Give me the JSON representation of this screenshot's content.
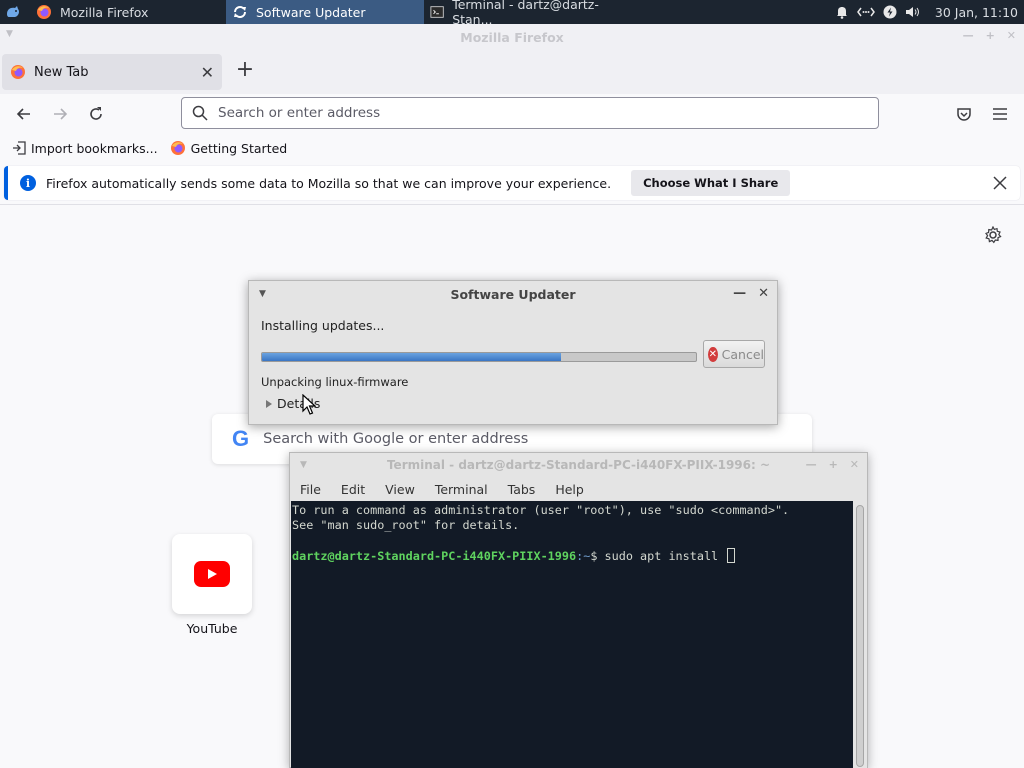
{
  "panel": {
    "tasks": [
      {
        "label": "Mozilla Firefox",
        "icon": "firefox-icon"
      },
      {
        "label": "Software Updater",
        "icon": "refresh-icon",
        "active": true
      },
      {
        "label": "Terminal - dartz@dartz-Stan...",
        "icon": "terminal-icon"
      }
    ],
    "clock": "30 Jan, 11:10"
  },
  "firefox": {
    "window_title": "Mozilla Firefox",
    "tab_label": "New Tab",
    "url_placeholder": "Search or enter address",
    "bookmarks": [
      {
        "label": "Import bookmarks...",
        "icon": "import-icon"
      },
      {
        "label": "Getting Started",
        "icon": "firefox-icon"
      }
    ],
    "infobar": {
      "message": "Firefox automatically sends some data to Mozilla so that we can improve your experience.",
      "button": "Choose What I Share"
    },
    "newtab": {
      "search_placeholder": "Search with Google or enter address",
      "tiles": [
        {
          "label": "YouTube"
        }
      ]
    }
  },
  "updater": {
    "title": "Software Updater",
    "status": "Installing updates...",
    "progress": 0.69,
    "cancel_label": "Cancel",
    "substatus": "Unpacking linux-firmware",
    "details_label": "Details"
  },
  "terminal": {
    "title": "Terminal - dartz@dartz-Standard-PC-i440FX-PIIX-1996: ~",
    "menu": [
      "File",
      "Edit",
      "View",
      "Terminal",
      "Tabs",
      "Help"
    ],
    "lines": [
      "To run a command as administrator (user \"root\"), use \"sudo <command>\".",
      "See \"man sudo_root\" for details."
    ],
    "prompt_user": "dartz@dartz-Standard-PC-i440FX-PIIX-1996",
    "prompt_path": ":~",
    "command": "$ sudo apt install "
  },
  "colors": {
    "panel_bg": "#1c2530",
    "active_task": "#3b5b83",
    "firefox_accent": "#0060df",
    "terminal_bg": "#121a26",
    "prompt_green": "#5fd35f"
  }
}
